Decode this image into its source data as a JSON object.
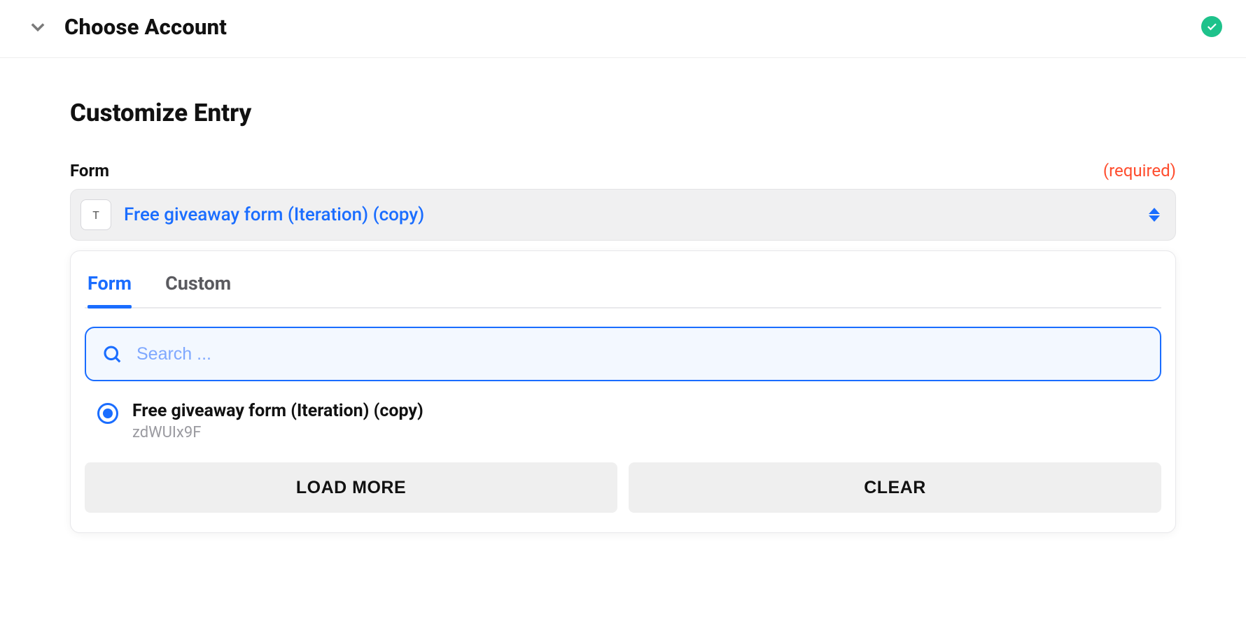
{
  "header": {
    "title": "Choose Account",
    "status": "success"
  },
  "section": {
    "title": "Customize Entry"
  },
  "form_field": {
    "label": "Form",
    "required_text": "(required)",
    "selected_value": "Free giveaway form (Iteration) (copy)",
    "icon_letter": "T"
  },
  "dropdown": {
    "tabs": [
      {
        "label": "Form",
        "active": true
      },
      {
        "label": "Custom",
        "active": false
      }
    ],
    "search": {
      "placeholder": "Search ...",
      "value": ""
    },
    "options": [
      {
        "title": "Free giveaway form (Iteration) (copy)",
        "subtitle": "zdWUIx9F",
        "selected": true
      }
    ],
    "actions": {
      "load_more": "LOAD MORE",
      "clear": "CLEAR"
    }
  }
}
